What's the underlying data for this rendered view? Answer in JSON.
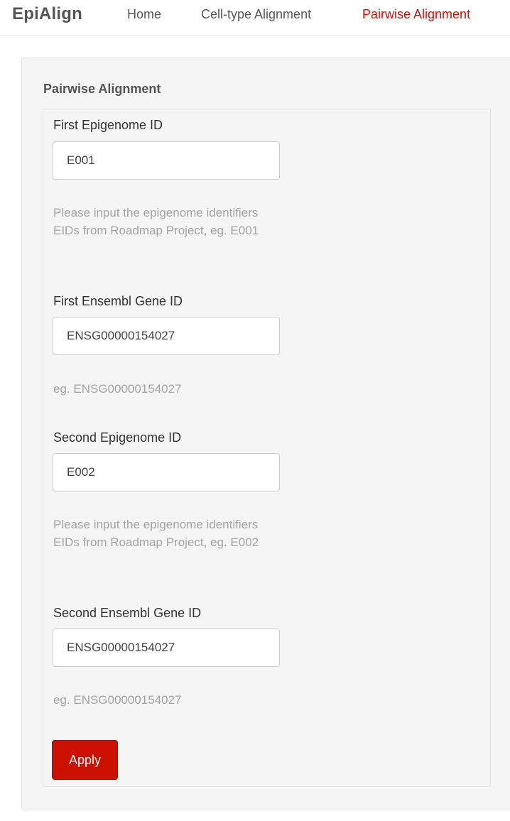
{
  "navbar": {
    "brand": "EpiAlign",
    "links": [
      {
        "label": "Home"
      },
      {
        "label": "Cell-type Alignment"
      },
      {
        "label": "Pairwise Alignment",
        "active": true
      }
    ]
  },
  "form": {
    "title": "Pairwise Alignment",
    "fields": [
      {
        "label": "First Epigenome ID",
        "value": "E001",
        "help": "Please input the epigenome identifiers EIDs from Roadmap Project, eg. E001"
      },
      {
        "label": "First Ensembl Gene ID",
        "value": "ENSG00000154027",
        "help": "eg. ENSG00000154027"
      },
      {
        "label": "Second Epigenome ID",
        "value": "E002",
        "help": "Please input the epigenome identifiers EIDs from Roadmap Project, eg. E002"
      },
      {
        "label": "Second Ensembl Gene ID",
        "value": "ENSG00000154027",
        "help": "eg. ENSG00000154027"
      }
    ],
    "apply_label": "Apply"
  },
  "colors": {
    "accent": "#cc1100",
    "panel_bg": "#f5f5f5",
    "help_text": "#a3a3a3"
  }
}
